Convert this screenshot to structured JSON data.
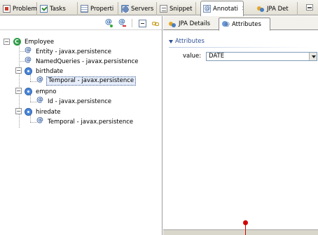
{
  "view_tabs": [
    {
      "label": "Problem",
      "icon": "problems-icon"
    },
    {
      "label": "Tasks",
      "icon": "tasks-icon"
    },
    {
      "label": "Properti",
      "icon": "properties-icon"
    },
    {
      "label": "Servers",
      "icon": "servers-icon"
    },
    {
      "label": "Snippet",
      "icon": "snippets-icon"
    },
    {
      "label": "Annotati",
      "icon": "annotations-icon",
      "active": true,
      "close": "✕"
    },
    {
      "label": "JPA Det",
      "icon": "jpa-details-icon"
    }
  ],
  "tree": {
    "root": {
      "label": "Employee",
      "expander": "−"
    },
    "items": [
      {
        "label": "Entity - javax.persistence",
        "icon": "annotation-icon"
      },
      {
        "label": "NamedQueries - javax.persistence",
        "icon": "annotation-icon"
      },
      {
        "label": "birthdate",
        "icon": "field-icon",
        "expander": "−"
      },
      {
        "label": "Temporal - javax.persistence",
        "icon": "annotation-icon",
        "selected": true
      },
      {
        "label": "empno",
        "icon": "field-icon",
        "expander": "−"
      },
      {
        "label": "Id - javax.persistence",
        "icon": "annotation-icon"
      },
      {
        "label": "hiredate",
        "icon": "field-icon",
        "expander": "−"
      },
      {
        "label": "Temporal - javax.persistence",
        "icon": "annotation-icon"
      }
    ]
  },
  "right_tabs": [
    {
      "label": "JPA Details",
      "icon": "jpa-details-icon"
    },
    {
      "label": "Attributes",
      "icon": "attributes-icon",
      "active": true
    }
  ],
  "attributes": {
    "section_title": "Attributes",
    "value_label": "value:",
    "value": "DATE"
  },
  "colors": {
    "selection_bg": "#e7eefb",
    "section_title": "#2f4f97",
    "marker": "#d00000"
  }
}
